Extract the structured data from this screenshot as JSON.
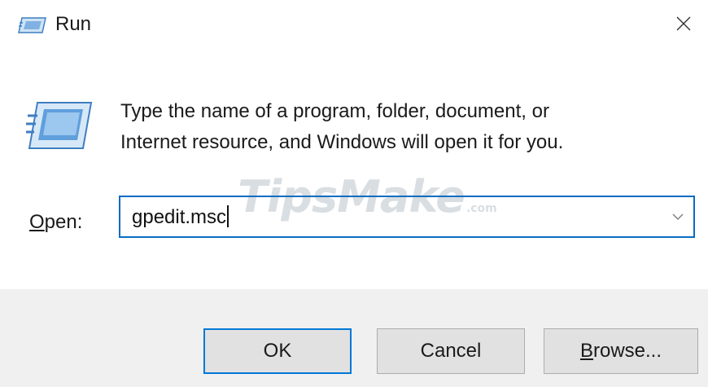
{
  "window": {
    "title": "Run",
    "app_icon": "run-icon",
    "close_icon": "close-icon"
  },
  "body": {
    "icon": "run-icon",
    "description_line1": "Type the name of a program, folder, document, or",
    "description_line2": "Internet resource, and Windows will open it for you.",
    "watermark_main": "TipsMake",
    "watermark_suffix": ".com"
  },
  "open": {
    "label_mnemonic": "O",
    "label_rest": "pen:",
    "value": "gpedit.msc",
    "dropdown_icon": "chevron-down-icon"
  },
  "buttons": {
    "ok_label": "OK",
    "cancel_label": "Cancel",
    "browse_mnemonic": "B",
    "browse_rest": "rowse..."
  },
  "colors": {
    "accent": "#0078d7",
    "footer_bg": "#f0f0f0",
    "button_bg": "#e1e1e1"
  }
}
